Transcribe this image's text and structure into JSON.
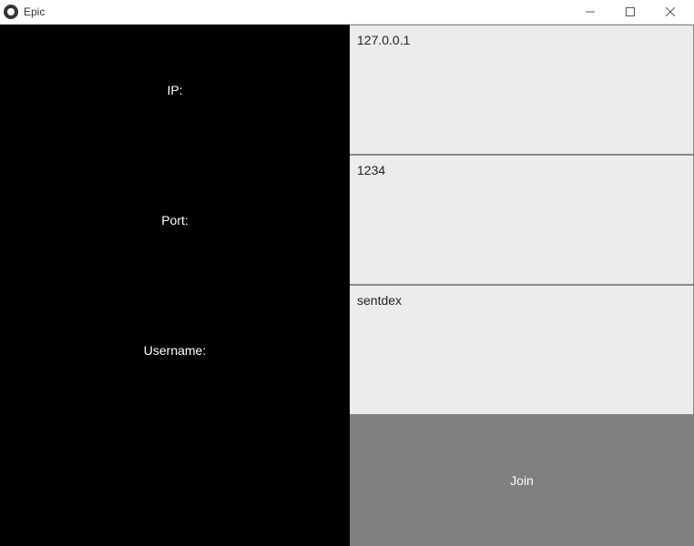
{
  "window": {
    "title": "Epic"
  },
  "labels": {
    "ip": "IP:",
    "port": "Port:",
    "username": "Username:"
  },
  "fields": {
    "ip": "127.0.0.1",
    "port": "1234",
    "username": "sentdex"
  },
  "buttons": {
    "join": "Join"
  }
}
